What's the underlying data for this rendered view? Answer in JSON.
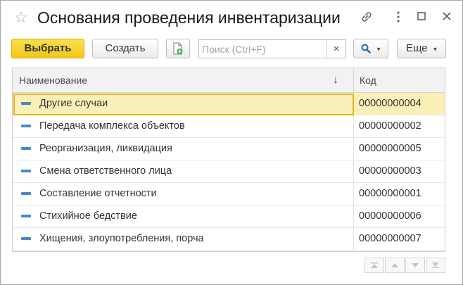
{
  "window": {
    "title": "Основания проведения инвентаризации",
    "favorite_icon": "star-icon",
    "link_icon": "link-icon",
    "maximize_icon": "maximize-icon",
    "close_icon": "close-icon"
  },
  "toolbar": {
    "select_label": "Выбрать",
    "create_label": "Создать",
    "copy_icon": "add-document-icon",
    "search_placeholder": "Поиск (Ctrl+F)",
    "search_clear": "×",
    "find_icon": "search-icon",
    "more_label": "Еще",
    "dropdown_glyph": "▾"
  },
  "table": {
    "columns": [
      {
        "label": "Наименование",
        "sort_glyph": "↓"
      },
      {
        "label": "Код"
      }
    ],
    "rows": [
      {
        "name": "Другие случаи",
        "code": "00000000004",
        "selected": true
      },
      {
        "name": "Передача комплекса объектов",
        "code": "00000000002"
      },
      {
        "name": "Реорганизация, ликвидация",
        "code": "00000000005"
      },
      {
        "name": "Смена ответственного лица",
        "code": "00000000003"
      },
      {
        "name": "Составление отчетности",
        "code": "00000000001"
      },
      {
        "name": "Стихийное бедствие",
        "code": "00000000006"
      },
      {
        "name": "Хищения, злоупотребления, порча",
        "code": "00000000007"
      }
    ]
  },
  "navigation": {
    "first_icon": "first-page-icon",
    "prev_icon": "prev-page-icon",
    "next_icon": "next-page-icon",
    "last_icon": "last-page-icon"
  },
  "colors": {
    "accent_yellow": "#f2c71b",
    "selected_row": "#fbefb8",
    "item_marker": "#4b88c0"
  }
}
